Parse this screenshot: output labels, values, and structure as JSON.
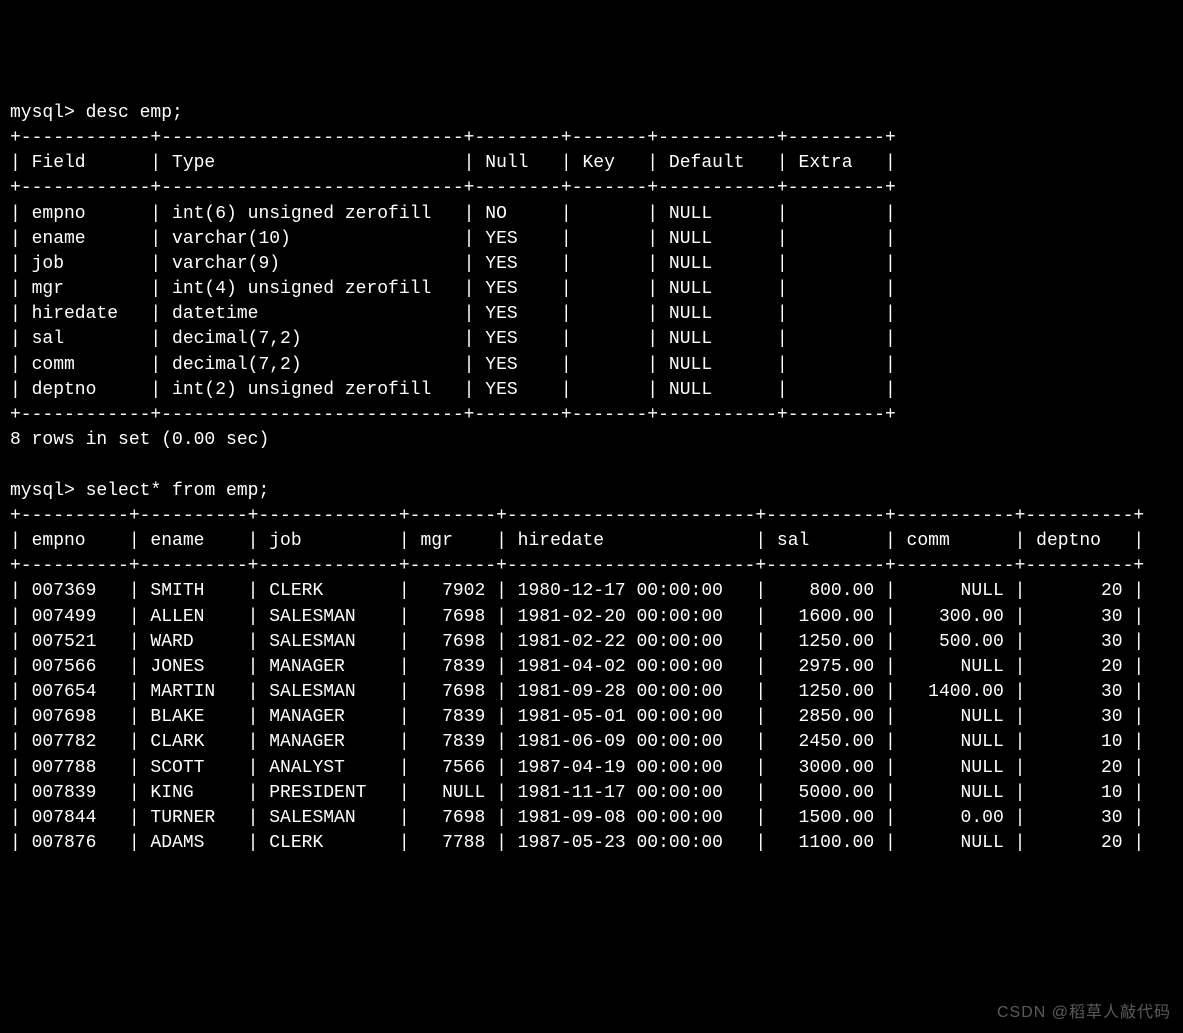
{
  "prompt": "mysql>",
  "commands": {
    "desc": "desc emp;",
    "select": "select* from emp;"
  },
  "desc_table": {
    "headers": [
      "Field",
      "Type",
      "Null",
      "Key",
      "Default",
      "Extra"
    ],
    "rows": [
      [
        "empno",
        "int(6) unsigned zerofill",
        "NO",
        "",
        "NULL",
        ""
      ],
      [
        "ename",
        "varchar(10)",
        "YES",
        "",
        "NULL",
        ""
      ],
      [
        "job",
        "varchar(9)",
        "YES",
        "",
        "NULL",
        ""
      ],
      [
        "mgr",
        "int(4) unsigned zerofill",
        "YES",
        "",
        "NULL",
        ""
      ],
      [
        "hiredate",
        "datetime",
        "YES",
        "",
        "NULL",
        ""
      ],
      [
        "sal",
        "decimal(7,2)",
        "YES",
        "",
        "NULL",
        ""
      ],
      [
        "comm",
        "decimal(7,2)",
        "YES",
        "",
        "NULL",
        ""
      ],
      [
        "deptno",
        "int(2) unsigned zerofill",
        "YES",
        "",
        "NULL",
        ""
      ]
    ],
    "footer": "8 rows in set (0.00 sec)"
  },
  "select_table": {
    "headers": [
      "empno",
      "ename",
      "job",
      "mgr",
      "hiredate",
      "sal",
      "comm",
      "deptno"
    ],
    "rows": [
      [
        "007369",
        "SMITH",
        "CLERK",
        "7902",
        "1980-12-17 00:00:00",
        "800.00",
        "NULL",
        "20"
      ],
      [
        "007499",
        "ALLEN",
        "SALESMAN",
        "7698",
        "1981-02-20 00:00:00",
        "1600.00",
        "300.00",
        "30"
      ],
      [
        "007521",
        "WARD",
        "SALESMAN",
        "7698",
        "1981-02-22 00:00:00",
        "1250.00",
        "500.00",
        "30"
      ],
      [
        "007566",
        "JONES",
        "MANAGER",
        "7839",
        "1981-04-02 00:00:00",
        "2975.00",
        "NULL",
        "20"
      ],
      [
        "007654",
        "MARTIN",
        "SALESMAN",
        "7698",
        "1981-09-28 00:00:00",
        "1250.00",
        "1400.00",
        "30"
      ],
      [
        "007698",
        "BLAKE",
        "MANAGER",
        "7839",
        "1981-05-01 00:00:00",
        "2850.00",
        "NULL",
        "30"
      ],
      [
        "007782",
        "CLARK",
        "MANAGER",
        "7839",
        "1981-06-09 00:00:00",
        "2450.00",
        "NULL",
        "10"
      ],
      [
        "007788",
        "SCOTT",
        "ANALYST",
        "7566",
        "1987-04-19 00:00:00",
        "3000.00",
        "NULL",
        "20"
      ],
      [
        "007839",
        "KING",
        "PRESIDENT",
        "NULL",
        "1981-11-17 00:00:00",
        "5000.00",
        "NULL",
        "10"
      ],
      [
        "007844",
        "TURNER",
        "SALESMAN",
        "7698",
        "1981-09-08 00:00:00",
        "1500.00",
        "0.00",
        "30"
      ],
      [
        "007876",
        "ADAMS",
        "CLERK",
        "7788",
        "1987-05-23 00:00:00",
        "1100.00",
        "NULL",
        "20"
      ]
    ]
  },
  "colwidths": {
    "desc": [
      10,
      26,
      6,
      5,
      9,
      7
    ],
    "select": [
      8,
      8,
      11,
      6,
      21,
      9,
      9,
      8
    ]
  },
  "align": {
    "desc": [
      "l",
      "l",
      "l",
      "l",
      "l",
      "l"
    ],
    "select": [
      "l",
      "l",
      "l",
      "r",
      "l",
      "r",
      "r",
      "r"
    ]
  },
  "watermark": "CSDN @稻草人敲代码"
}
